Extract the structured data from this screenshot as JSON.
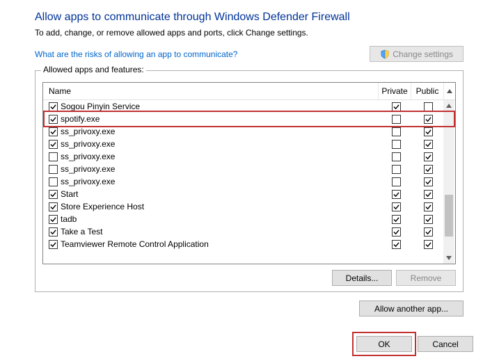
{
  "heading": "Allow apps to communicate through Windows Defender Firewall",
  "subheading": "To add, change, or remove allowed apps and ports, click Change settings.",
  "risk_link": "What are the risks of allowing an app to communicate?",
  "change_settings_btn": "Change settings",
  "group_label": "Allowed apps and features:",
  "columns": {
    "name": "Name",
    "private": "Private",
    "public": "Public"
  },
  "rows": [
    {
      "name": "Sogou Pinyin Service",
      "enabled": true,
      "private": true,
      "public": false
    },
    {
      "name": "spotify.exe",
      "enabled": true,
      "private": false,
      "public": true,
      "highlighted": true
    },
    {
      "name": "ss_privoxy.exe",
      "enabled": true,
      "private": false,
      "public": true
    },
    {
      "name": "ss_privoxy.exe",
      "enabled": true,
      "private": false,
      "public": true
    },
    {
      "name": "ss_privoxy.exe",
      "enabled": false,
      "private": false,
      "public": true
    },
    {
      "name": "ss_privoxy.exe",
      "enabled": false,
      "private": false,
      "public": true
    },
    {
      "name": "ss_privoxy.exe",
      "enabled": false,
      "private": false,
      "public": true
    },
    {
      "name": "Start",
      "enabled": true,
      "private": true,
      "public": true
    },
    {
      "name": "Store Experience Host",
      "enabled": true,
      "private": true,
      "public": true
    },
    {
      "name": "tadb",
      "enabled": true,
      "private": true,
      "public": true
    },
    {
      "name": "Take a Test",
      "enabled": true,
      "private": true,
      "public": true
    },
    {
      "name": "Teamviewer Remote Control Application",
      "enabled": true,
      "private": true,
      "public": true
    }
  ],
  "details_btn": "Details...",
  "remove_btn": "Remove",
  "allow_another_btn": "Allow another app...",
  "ok_btn": "OK",
  "cancel_btn": "Cancel"
}
